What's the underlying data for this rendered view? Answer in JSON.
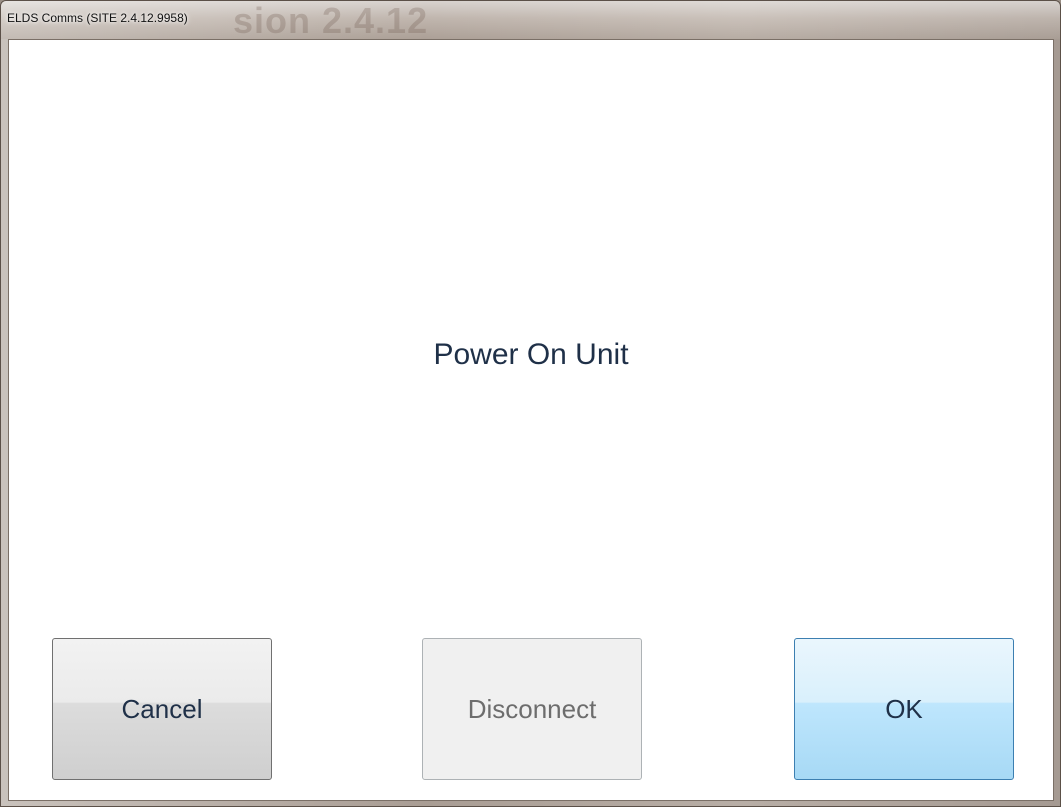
{
  "window": {
    "title": "ELDS Comms (SITE 2.4.12.9958)",
    "background_title": "sion 2.4.12"
  },
  "dialog": {
    "message": "Power On Unit"
  },
  "buttons": {
    "cancel": "Cancel",
    "disconnect": "Disconnect",
    "ok": "OK"
  }
}
